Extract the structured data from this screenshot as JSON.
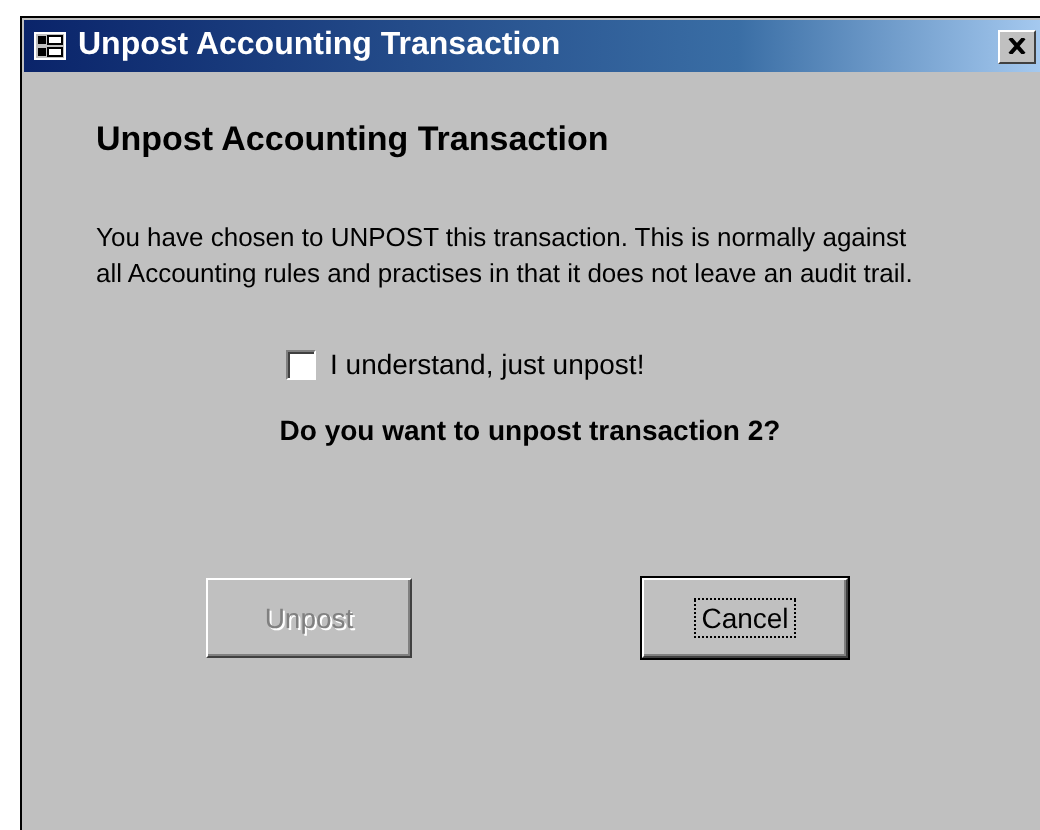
{
  "window": {
    "title": "Unpost Accounting Transaction"
  },
  "heading": "Unpost Accounting Transaction",
  "message": "You have chosen to UNPOST this transaction. This is normally against all Accounting rules and practises in that it does not leave an audit trail.",
  "confirm_checkbox": {
    "label": "I understand, just unpost!",
    "checked": false
  },
  "question": "Do you want to unpost transaction 2?",
  "buttons": [
    {
      "label": "Unpost",
      "disabled": true,
      "focused": false
    },
    {
      "label": "Cancel",
      "disabled": false,
      "focused": true
    }
  ]
}
